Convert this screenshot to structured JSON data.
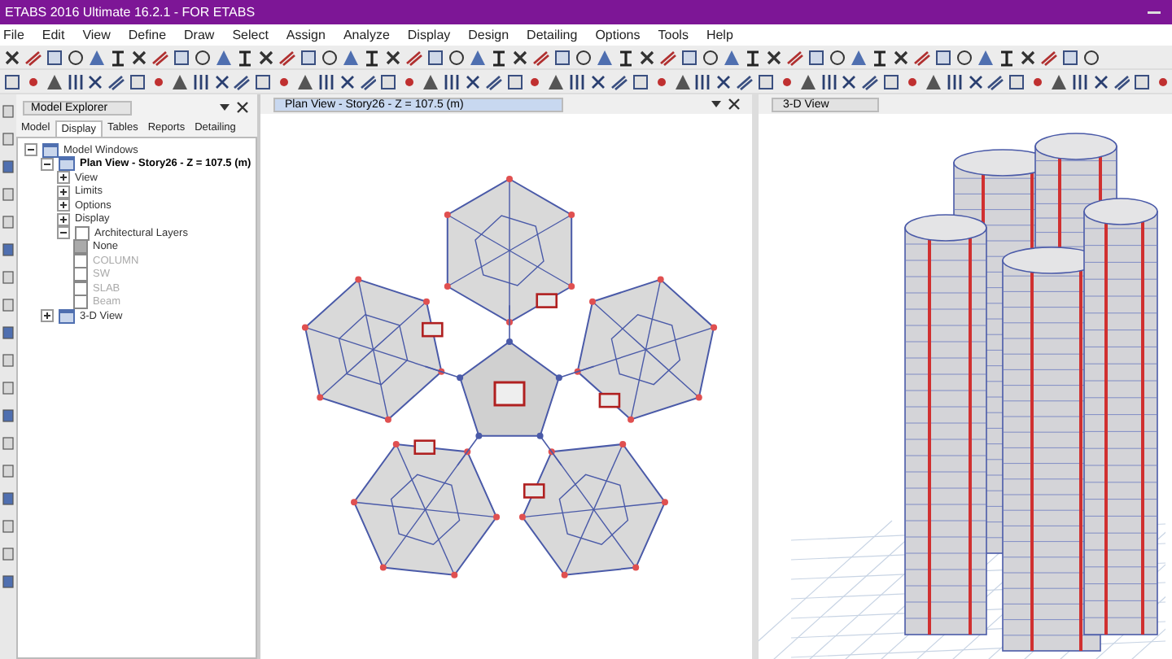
{
  "window": {
    "title": "ETABS 2016 Ultimate 16.2.1 - FOR ETABS"
  },
  "menu": [
    "File",
    "Edit",
    "View",
    "Define",
    "Draw",
    "Select",
    "Assign",
    "Analyze",
    "Display",
    "Design",
    "Detailing",
    "Options",
    "Tools",
    "Help"
  ],
  "explorer": {
    "title": "Model Explorer",
    "tabs": [
      {
        "label": "Model",
        "selected": false
      },
      {
        "label": "Display",
        "selected": true
      },
      {
        "label": "Tables",
        "selected": false
      },
      {
        "label": "Reports",
        "selected": false
      },
      {
        "label": "Detailing",
        "selected": false
      }
    ],
    "tree": [
      {
        "label": "Model Windows",
        "kind": "root",
        "expanded": true,
        "children": [
          {
            "label": "Plan View - Story26 - Z = 107.5 (m)",
            "kind": "window",
            "expanded": true,
            "bold": true,
            "children": [
              {
                "label": "View",
                "kind": "folder",
                "expanded": false
              },
              {
                "label": "Limits",
                "kind": "folder",
                "expanded": false
              },
              {
                "label": "Options",
                "kind": "folder",
                "expanded": false
              },
              {
                "label": "Display",
                "kind": "folder",
                "expanded": false
              },
              {
                "label": "Architectural Layers",
                "kind": "check",
                "expanded": true,
                "checked": false,
                "children": [
                  {
                    "label": "None",
                    "kind": "layer",
                    "checked": true,
                    "disabled": false
                  },
                  {
                    "label": "COLUMN",
                    "kind": "layer",
                    "checked": false,
                    "disabled": true
                  },
                  {
                    "label": "SW",
                    "kind": "layer",
                    "checked": false,
                    "disabled": true
                  },
                  {
                    "label": "SLAB",
                    "kind": "layer",
                    "checked": false,
                    "disabled": true
                  },
                  {
                    "label": "Beam",
                    "kind": "layer",
                    "checked": false,
                    "disabled": true
                  }
                ]
              }
            ]
          },
          {
            "label": "3-D View",
            "kind": "window",
            "expanded": false,
            "bold": false
          }
        ]
      }
    ]
  },
  "views": [
    {
      "title": "Plan View - Story26 - Z = 107.5 (m)",
      "kind": "plan",
      "selected": true
    },
    {
      "title": "3-D View",
      "kind": "perspective",
      "selected": false
    }
  ]
}
